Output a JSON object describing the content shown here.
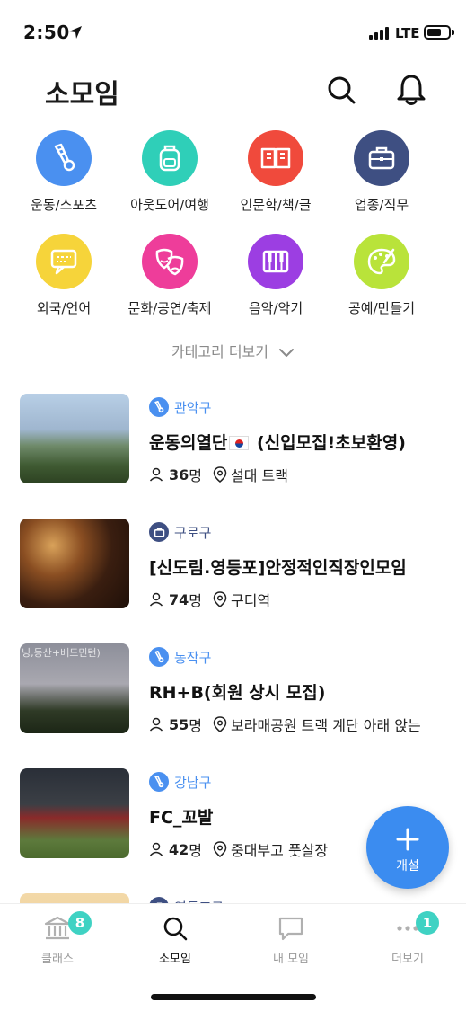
{
  "status": {
    "time": "2:50",
    "network": "LTE"
  },
  "header": {
    "title": "소모임",
    "icons": [
      "search-icon",
      "bell-icon"
    ]
  },
  "categories": [
    {
      "label": "운동/스포츠",
      "icon": "badminton-icon",
      "color": "#4a90f0"
    },
    {
      "label": "아웃도어/여행",
      "icon": "backpack-icon",
      "color": "#2fcfb8"
    },
    {
      "label": "인문학/책/글",
      "icon": "book-icon",
      "color": "#f04a3c"
    },
    {
      "label": "업종/직무",
      "icon": "briefcase-icon",
      "color": "#3e4f82"
    },
    {
      "label": "외국/언어",
      "icon": "language-bubble-icon",
      "color": "#f6d43a"
    },
    {
      "label": "문화/공연/축제",
      "icon": "theater-masks-icon",
      "color": "#ee3d9a"
    },
    {
      "label": "음악/악기",
      "icon": "piano-icon",
      "color": "#9c3ee2"
    },
    {
      "label": "공예/만들기",
      "icon": "palette-icon",
      "color": "#b9e33a"
    }
  ],
  "more_categories": "카테고리 더보기",
  "groups": [
    {
      "region": "관악구",
      "category_color": "#4a90f0",
      "title_before": "운동의열단",
      "has_flag": true,
      "title_after": " (신입모집!초보환영)",
      "members": "36",
      "members_unit": "명",
      "location": "설대 트랙"
    },
    {
      "region": "구로구",
      "category_color": "#3e4f82",
      "title_before": "[신도림.영등포]안정적인직장인모임",
      "has_flag": false,
      "title_after": "",
      "members": "74",
      "members_unit": "명",
      "location": "구디역"
    },
    {
      "region": "동작구",
      "category_color": "#4a90f0",
      "title_before": "RH+B(회원 상시 모집)",
      "has_flag": false,
      "title_after": "",
      "members": "55",
      "members_unit": "명",
      "location": "보라매공원 트랙 계단 아래 앉는",
      "thumb_text": "닝,등산+배드민턴)"
    },
    {
      "region": "강남구",
      "category_color": "#4a90f0",
      "title_before": "FC_꼬발",
      "has_flag": false,
      "title_after": "",
      "members": "42",
      "members_unit": "명",
      "location": "중대부고 풋살장"
    },
    {
      "region": "영등포구",
      "category_color": "#3e4f82"
    }
  ],
  "fab": {
    "label": "개설"
  },
  "tabs": [
    {
      "label": "클래스",
      "icon": "bank-icon",
      "badge": "8"
    },
    {
      "label": "소모임",
      "icon": "search-icon",
      "active": true
    },
    {
      "label": "내 모임",
      "icon": "chat-bubble-icon"
    },
    {
      "label": "더보기",
      "icon": "more-dots-icon",
      "badge": "1"
    }
  ],
  "colors": {
    "accent": "#3b8cf0",
    "badge": "#3fd2c3",
    "region_text": "#4a90f0"
  }
}
